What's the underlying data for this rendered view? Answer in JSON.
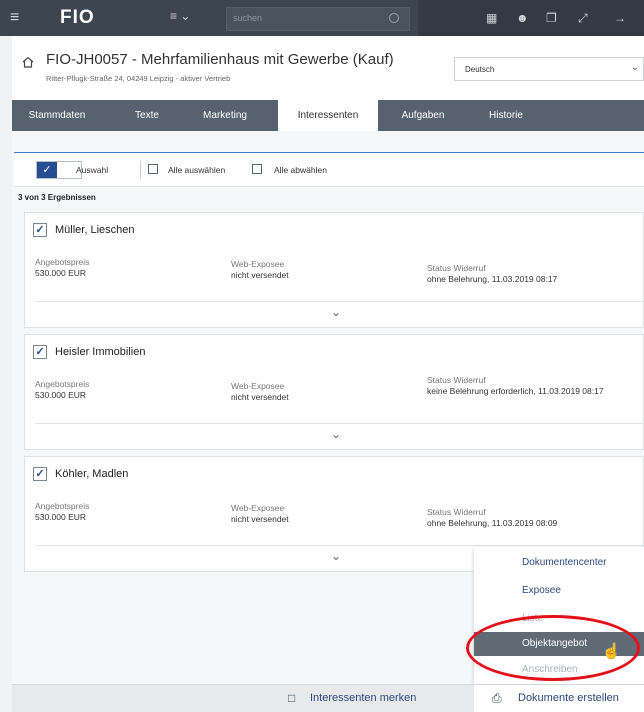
{
  "topbar": {
    "menu_icon": "hamburger-icon",
    "logo": "FIO",
    "search_placeholder": "suchen",
    "tool_icons": [
      "notes-icon",
      "user-icon",
      "window-icon",
      "expand-icon",
      "arrow-icon"
    ]
  },
  "header": {
    "title": "FIO-JH0057 - Mehrfamilienhaus mit Gewerbe (Kauf)",
    "subtitle": "Ritter-Pflugk-Straße 24, 04249 Leipzig - aktiver Vertrieb",
    "language": "Deutsch"
  },
  "tabs": [
    {
      "label": "Stammdaten"
    },
    {
      "label": "Texte"
    },
    {
      "label": "Marketing"
    },
    {
      "label": "Interessenten",
      "active": true
    },
    {
      "label": "Aufgaben"
    },
    {
      "label": "Historie"
    }
  ],
  "selection": {
    "toggle_label": "Auswahl",
    "select_all": "Alle auswählen",
    "deselect_all": "Alle abwählen"
  },
  "result_count": "3 von 3 Ergebnissen",
  "entries": [
    {
      "name": "Müller, Lieschen",
      "price_label": "Angebotspreis",
      "price": "530.000 EUR",
      "expose_label": "Web-Exposee",
      "expose": "nicht versendet",
      "status_label": "Status Widerruf",
      "status": "ohne Belehrung, 11.03.2019 08:17"
    },
    {
      "name": "Heisler Immobilien",
      "price_label": "Angebotspreis",
      "price": "530.000 EUR",
      "expose_label": "Web-Exposee",
      "expose": "nicht versendet",
      "status_label": "Status Widerruf",
      "status": "keine Belehrung erforderlich, 11.03.2019 08:17"
    },
    {
      "name": "Köhler, Madlen",
      "price_label": "Angebotspreis",
      "price": "530.000 EUR",
      "expose_label": "Web-Exposee",
      "expose": "nicht versendet",
      "status_label": "Status Widerruf",
      "status": "ohne Belehrung, 11.03.2019 08:09"
    }
  ],
  "dropdown": {
    "items": [
      {
        "label": "Dokumentencenter"
      },
      {
        "label": "Exposee"
      },
      {
        "label": "Liste"
      },
      {
        "label": "Objektangebot",
        "highlighted": true
      },
      {
        "label": "Anschreiben"
      }
    ]
  },
  "bottombar": {
    "remember": "Interessenten merken",
    "create_docs": "Dokumente erstellen"
  },
  "colors": {
    "topbar": "#3d4550",
    "tabbar": "#56626e",
    "accent": "#264d8f",
    "highlight": "#5f6a75",
    "annotation": "#e3111b"
  }
}
